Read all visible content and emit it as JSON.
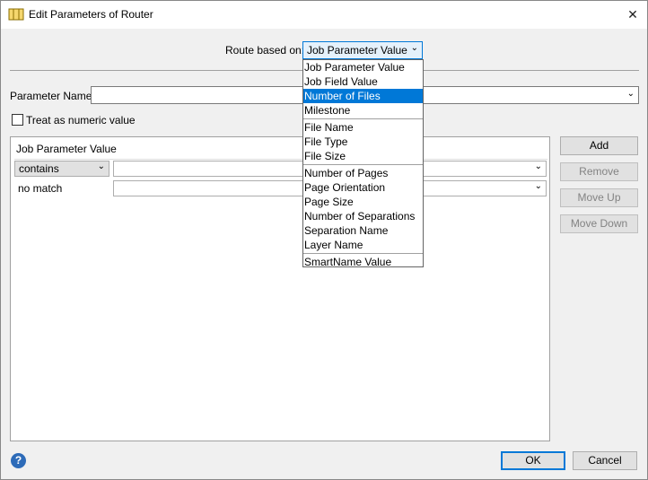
{
  "window": {
    "title": "Edit Parameters of Router"
  },
  "route": {
    "label": "Route based on:",
    "value": "Job Parameter Value"
  },
  "dropdown": {
    "groups": [
      [
        "Job Parameter Value",
        "Job Field Value",
        "Number of Files",
        "Milestone"
      ],
      [
        "File Name",
        "File Type",
        "File Size"
      ],
      [
        "Number of Pages",
        "Page Orientation",
        "Page Size",
        "Number of Separations",
        "Separation Name",
        "Layer Name"
      ],
      [
        "SmartName Value"
      ]
    ],
    "highlighted": "Number of Files"
  },
  "parameter": {
    "label": "Parameter Name:",
    "value": ""
  },
  "numeric": {
    "label": "Treat as numeric value",
    "checked": false
  },
  "rules": {
    "header": "Job Parameter Value",
    "operator": "contains",
    "value": "",
    "nomatch_label": "no match",
    "nomatch_value": ""
  },
  "buttons": {
    "add": "Add",
    "remove": "Remove",
    "move_up": "Move Up",
    "move_down": "Move Down",
    "ok": "OK",
    "cancel": "Cancel"
  },
  "icons": {
    "app": "router-icon",
    "close": "close-icon",
    "help": "help-icon"
  },
  "colors": {
    "accent": "#0078d7",
    "help": "#2d6bb8"
  }
}
